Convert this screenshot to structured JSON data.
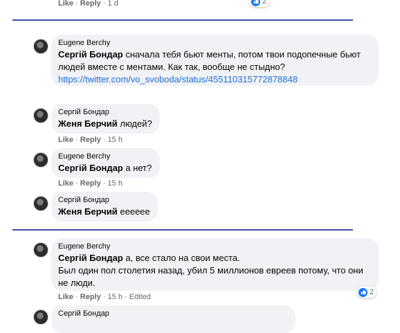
{
  "colors": {
    "link": "#216fdb",
    "divider": "#3b4fa6",
    "like": "#1877f2",
    "bubble": "#f0f2f5"
  },
  "top": {
    "like": "Like",
    "reply": "Reply",
    "time": "1 d",
    "reaction_count": "2"
  },
  "comments": [
    {
      "author": "Eugene Berchy",
      "mention": "Сергій Бондар",
      "text": " сначала тебя бьют менты, потом твои подопечные бьют людей вместе с ментами. Как так, вообще не стыдно?",
      "link": "https://twitter.com/vo_svoboda/status/455110315772878848"
    },
    {
      "author": "Сергій Бондар",
      "mention": "Женя Берчий",
      "text": " людей?",
      "like": "Like",
      "reply": "Reply",
      "time": "15 h"
    },
    {
      "author": "Eugene Berchy",
      "mention": "Сергій Бондар",
      "text": " а нет?",
      "like": "Like",
      "reply": "Reply",
      "time": "15 h"
    },
    {
      "author": "Сергій Бондар",
      "mention": "Женя Берчий",
      "text": " ееееее"
    },
    {
      "author": "Eugene Berchy",
      "mention": "Сергій Бондар",
      "text": " а, все стало на свои места.",
      "text2": "Был один пол столетия назад, убил 5 миллионов евреев потому, что они не люди.",
      "like": "Like",
      "reply": "Reply",
      "time": "15 h",
      "edited": "Edited",
      "reaction_count": "2"
    },
    {
      "author": "Сергій Бондар"
    }
  ]
}
